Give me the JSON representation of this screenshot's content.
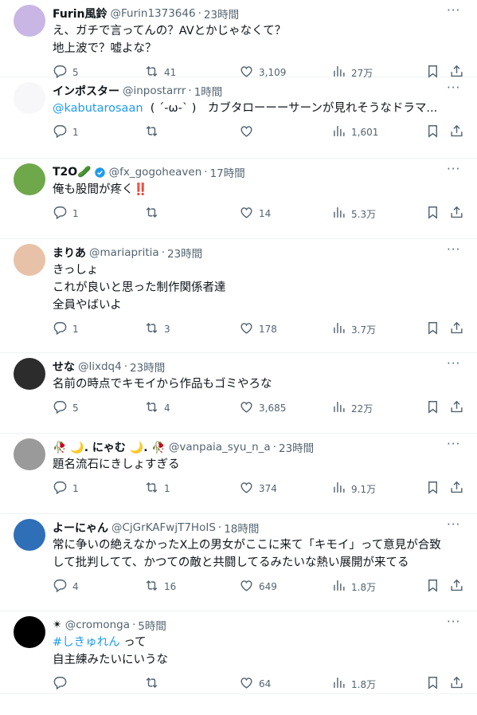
{
  "tweets": [
    {
      "name": "Furin風鈴",
      "handle": "@Furin1373646",
      "time": "23時間",
      "body": "え、ガチで言ってんの？AVとかじゃなくて？\n地上波で？嘘よな？",
      "reply": "5",
      "retweet": "41",
      "like": "3,109",
      "views": "27万"
    },
    {
      "name": "インポスター",
      "handle": "@inpostarrr",
      "time": "1時間",
      "mention": "@kabutarosaan",
      "body": "  ( ´-ω-` )　カブタローーーサーンが見れそうなドラマ...",
      "reply": "1",
      "retweet": "",
      "like": "",
      "views": "1,601"
    },
    {
      "name": "T2O🥒",
      "handle": "@fx_gogoheaven",
      "time": "17時間",
      "body": "俺も股間が疼く‼️",
      "reply": "1",
      "retweet": "",
      "like": "14",
      "views": "5.3万"
    },
    {
      "name": "まりあ",
      "handle": "@mariapritia",
      "time": "23時間",
      "body": "きっしょ\nこれが良いと思った制作関係者達\n全員やばいよ",
      "reply": "1",
      "retweet": "3",
      "like": "178",
      "views": "3.7万"
    },
    {
      "name": "せな",
      "handle": "@lixdq4",
      "time": "23時間",
      "body": "名前の時点でキモイから作品もゴミやろな",
      "reply": "5",
      "retweet": "4",
      "like": "3,685",
      "views": "22万"
    },
    {
      "name": "🥀 🌙. にゃむ 🌙. 🥀",
      "handle": "@vanpaia_syu_n_a",
      "time": "23時間",
      "body": "題名流石にきしょすぎる",
      "reply": "1",
      "retweet": "1",
      "like": "374",
      "views": "9.1万"
    },
    {
      "name": "よーにゃん",
      "handle": "@CjGrKAFwjT7HoIS",
      "time": "18時間",
      "body": "常に争いの絶えなかったX上の男女がここに来て「キモイ」って意見が合致\nして批判してて、かつての敵と共闘してるみたいな熱い展開が来てる",
      "reply": "4",
      "retweet": "16",
      "like": "649",
      "views": "1.8万"
    },
    {
      "name": "✴",
      "handle": "@cromonga",
      "time": "5時間",
      "hashtag": "#しきゅれん",
      "body": " って\n自主練みたいにいうな",
      "reply": "",
      "retweet": "",
      "like": "64",
      "views": "1.8万"
    }
  ]
}
